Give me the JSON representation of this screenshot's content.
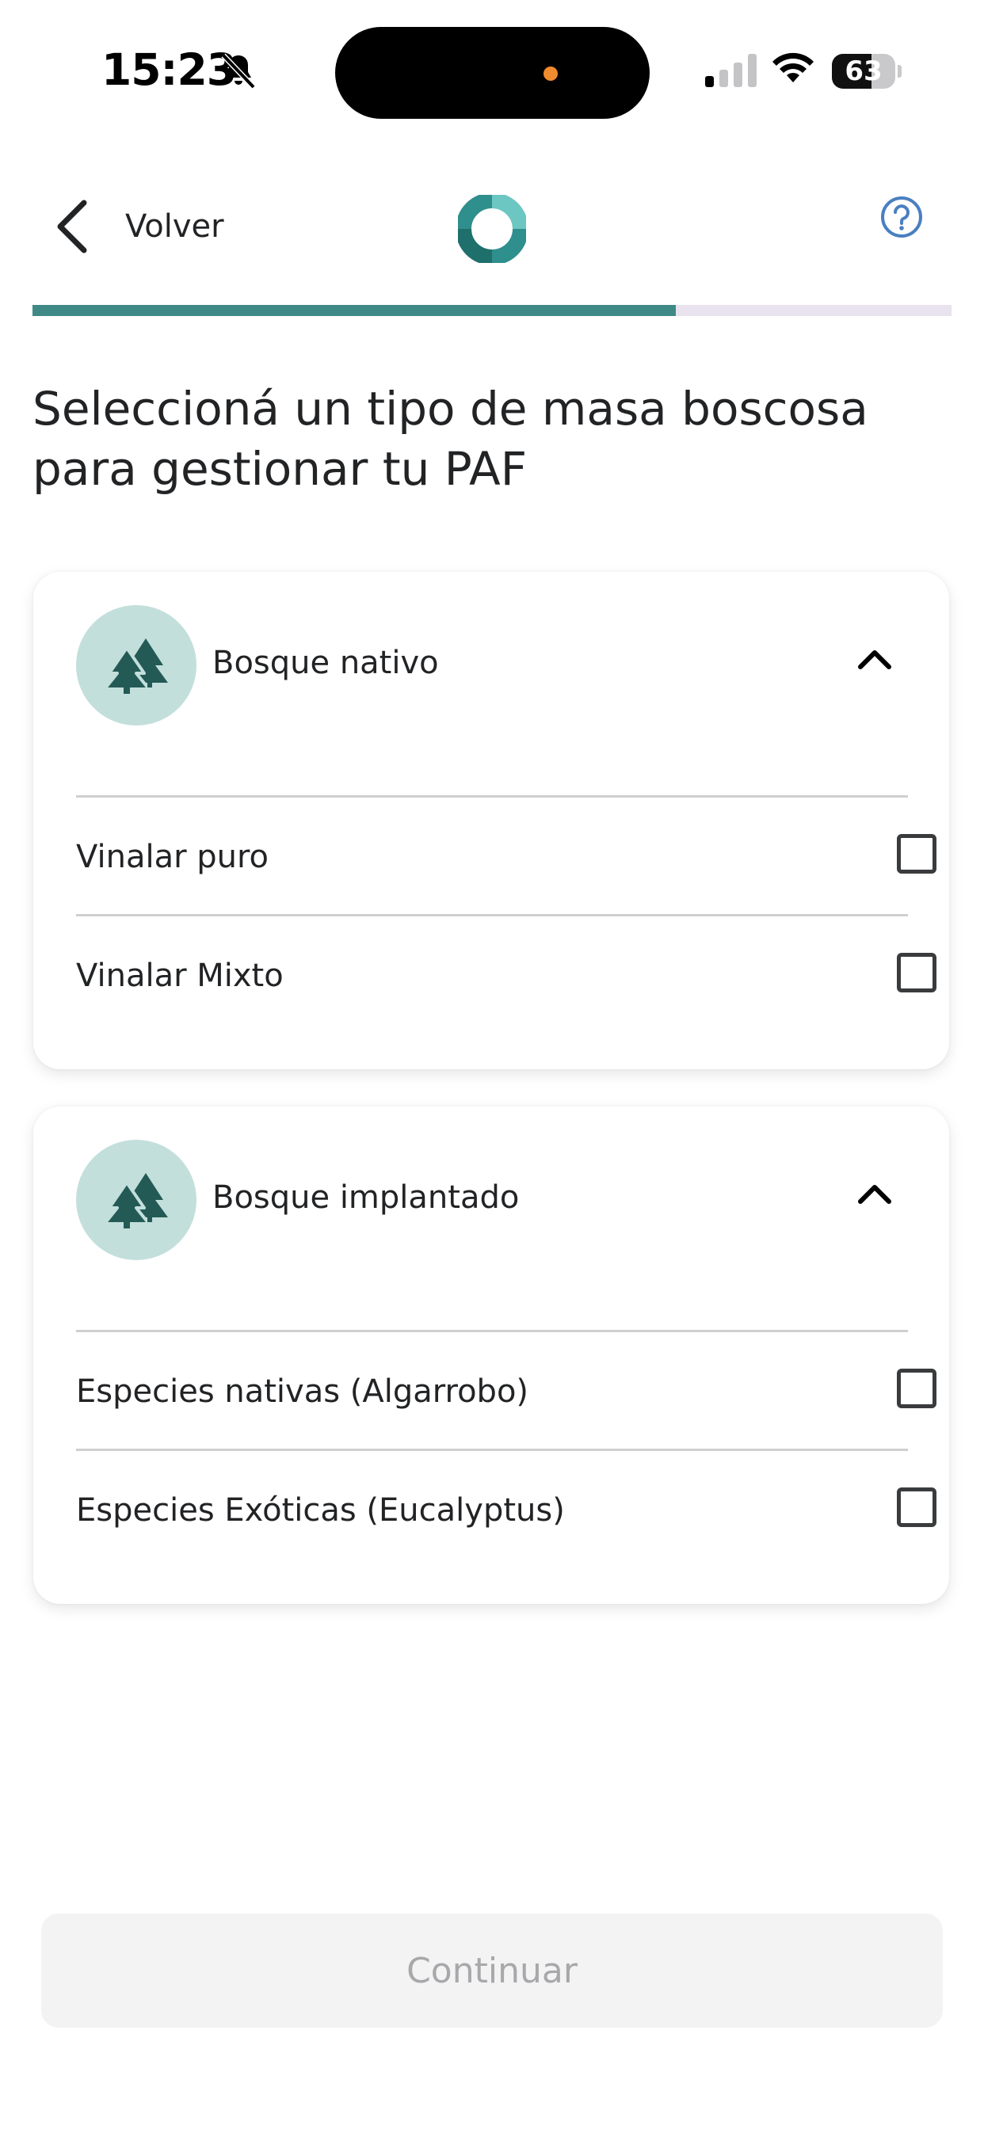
{
  "status_bar": {
    "time": "15:23",
    "battery_level": "63",
    "battery_fraction": 0.63,
    "icons": [
      "bell-slash-icon",
      "cellular-signal-icon",
      "wifi-icon",
      "battery-icon"
    ]
  },
  "header": {
    "back_label": "Volver",
    "logo_icon": "app-logo-icon",
    "help_icon": "help-circle-icon"
  },
  "progress": {
    "fraction": 0.7
  },
  "title": "Seleccioná un tipo de masa boscosa para gestionar tu PAF",
  "groups": [
    {
      "title": "Bosque nativo",
      "icon": "trees-icon",
      "expanded": true,
      "options": [
        {
          "label": "Vinalar puro",
          "checked": false
        },
        {
          "label": "Vinalar Mixto",
          "checked": false
        }
      ]
    },
    {
      "title": "Bosque implantado",
      "icon": "trees-icon",
      "expanded": true,
      "options": [
        {
          "label": "Especies nativas (Algarrobo)",
          "checked": false
        },
        {
          "label": "Especies Exóticas (Eucalyptus)",
          "checked": false
        }
      ]
    }
  ],
  "continue_label": "Continuar",
  "colors": {
    "accent": "#3f8a86",
    "icon_bg": "#c3dfdb",
    "icon_fg": "#245a56",
    "help": "#4a7fc1",
    "button_bg": "#f3f3f4",
    "button_text": "#a8a8ab"
  }
}
